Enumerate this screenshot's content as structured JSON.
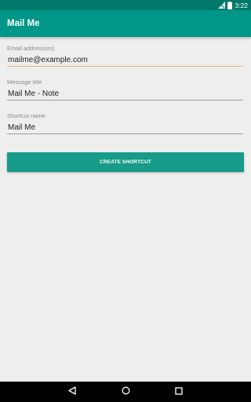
{
  "status_bar": {
    "time": "3:22",
    "icons": [
      "signal-icon",
      "battery-icon"
    ]
  },
  "app_bar": {
    "title": "Mail Me"
  },
  "form": {
    "email": {
      "label": "Email address(es)",
      "value": "mailme@example.com"
    },
    "message_title": {
      "label": "Message title",
      "value": "Mail Me - Note"
    },
    "shortcut_name": {
      "label": "Shortcut name",
      "value": "Mail Me"
    },
    "create_button_label": "CREATE SHORTCUT"
  },
  "nav_bar": {
    "icons": [
      "back-icon",
      "home-icon",
      "recents-icon"
    ]
  },
  "colors": {
    "status_bar": "#00796b",
    "app_bar": "#009688",
    "button": "#169c89",
    "focus_underline": "#f0b27a",
    "background": "#eeeeee"
  }
}
